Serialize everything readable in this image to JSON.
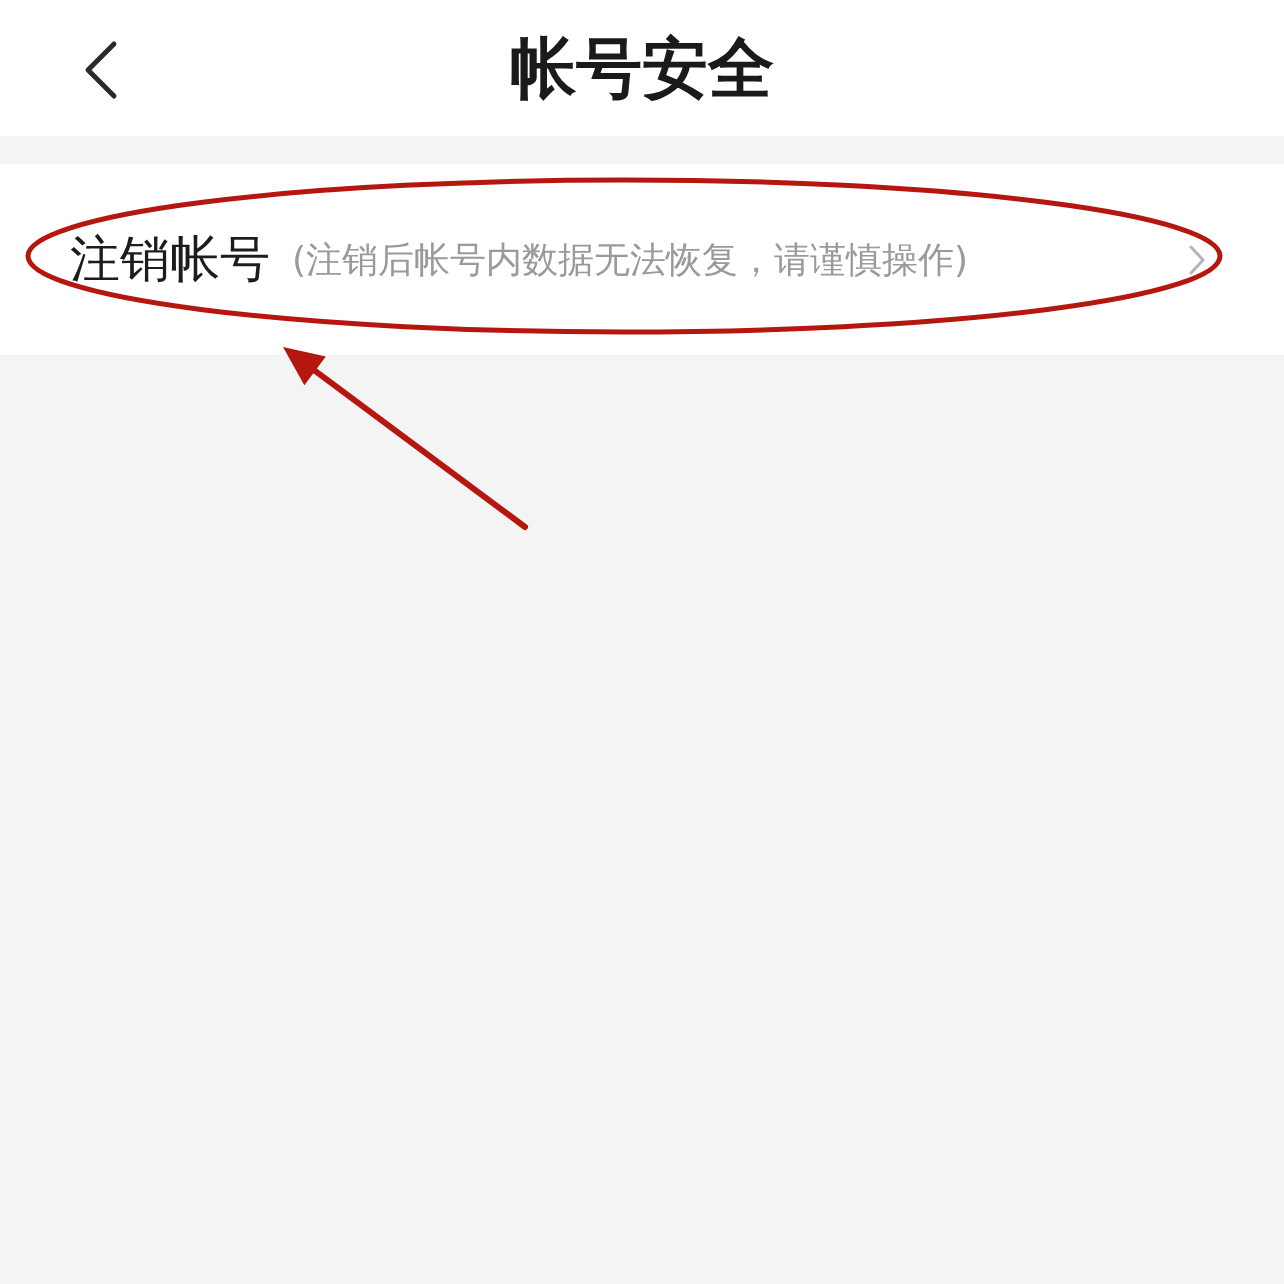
{
  "header": {
    "title": "帐号安全"
  },
  "settings": [
    {
      "label": "注销帐号",
      "hint": "(注销后帐号内数据无法恢复，请谨慎操作)"
    }
  ],
  "annotations": [
    {
      "kind": "ellipse"
    },
    {
      "kind": "arrow"
    }
  ]
}
